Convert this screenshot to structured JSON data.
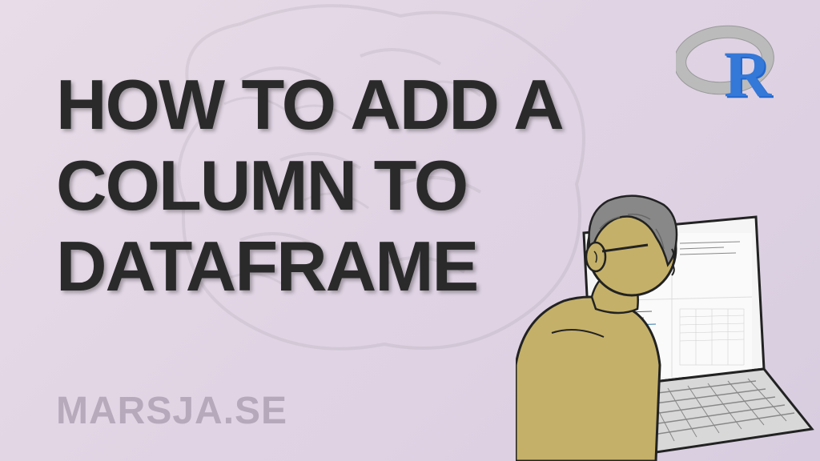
{
  "title": {
    "line1": "HOW TO ADD A",
    "line2": "COLUMN TO",
    "line3": "DATAFRAME"
  },
  "watermark": "MARSJA.SE",
  "logo": {
    "letter": "R"
  }
}
